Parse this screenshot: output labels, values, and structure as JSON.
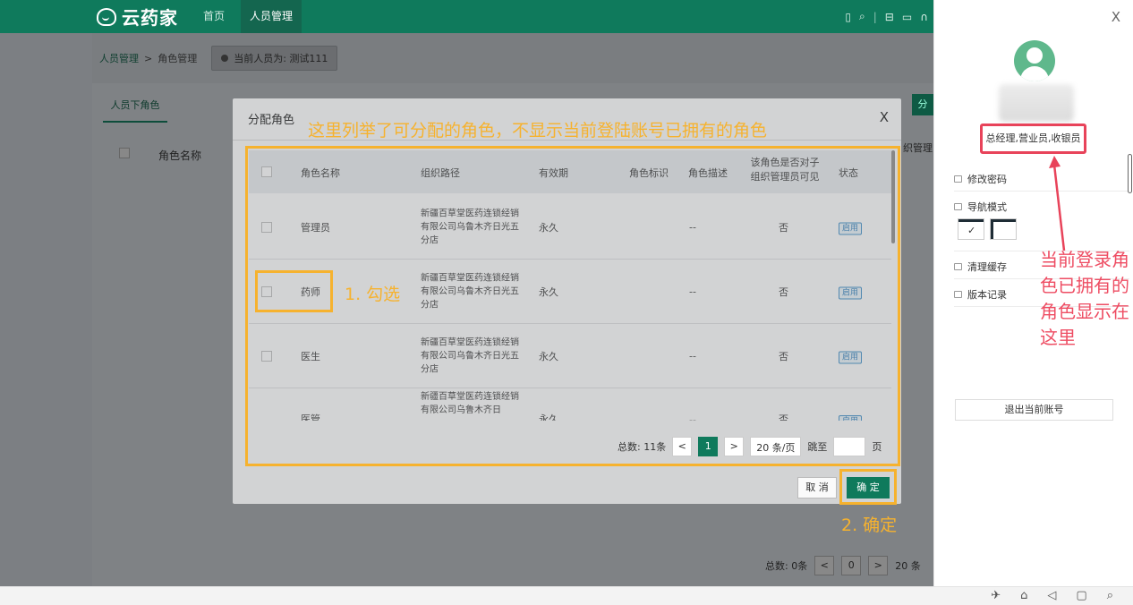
{
  "topbar": {
    "brand": "云药家",
    "nav": [
      "首页",
      "人员管理"
    ],
    "icons": [
      "book-icon",
      "search-icon",
      "lock-icon",
      "save-icon",
      "headset-icon"
    ]
  },
  "breadcrumb": {
    "parent": "人员管理",
    "separator": ">",
    "current": "角色管理",
    "current_user_label": "当前人员为: 测试111"
  },
  "background_page": {
    "tab": "人员下角色",
    "column": "角色名称",
    "right_button": "分",
    "right_text": "织管理",
    "pagination": {
      "total": "总数: 0条",
      "page": "0",
      "per_page": "20 条"
    }
  },
  "modal": {
    "title": "分配角色",
    "close": "X",
    "columns": [
      "角色名称",
      "组织路径",
      "有效期",
      "角色标识",
      "角色描述",
      "该角色是否对子组织管理员可见",
      "状态"
    ],
    "rows": [
      {
        "name": "管理员",
        "org": "新疆百草堂医药连锁经销有限公司乌鲁木齐日光五分店",
        "valid": "永久",
        "desc": "--",
        "visible": "否",
        "status": "启用"
      },
      {
        "name": "药师",
        "org": "新疆百草堂医药连锁经销有限公司乌鲁木齐日光五分店",
        "valid": "永久",
        "desc": "--",
        "visible": "否",
        "status": "启用"
      },
      {
        "name": "医生",
        "org": "新疆百草堂医药连锁经销有限公司乌鲁木齐日光五分店",
        "valid": "永久",
        "desc": "--",
        "visible": "否",
        "status": "启用"
      },
      {
        "name": "医管",
        "org": "新疆百草堂医药连锁经销有限公司乌鲁木齐日",
        "valid": "永久",
        "desc": "--",
        "visible": "否",
        "status": "启用"
      }
    ],
    "pagination": {
      "total": "总数: 11条",
      "prev": "<",
      "page": "1",
      "next": ">",
      "per_page": "20 条/页",
      "jump": "跳至",
      "page_unit": "页"
    },
    "cancel": "取 消",
    "confirm": "确 定"
  },
  "annotations": {
    "top_note": "这里列举了可分配的角色，不显示当前登陆账号已拥有的角色",
    "step1": "1. 勾选",
    "step2": "2. 确定",
    "drawer_note": "当前登录角色已拥有的角色显示在这里",
    "colors": {
      "orange": "#f6b22e",
      "red": "#e8435a"
    }
  },
  "drawer": {
    "close": "X",
    "roles": "总经理,营业员,收银员",
    "menu": [
      "修改密码",
      "导航模式",
      "清理缓存",
      "版本记录"
    ],
    "nav_mode_selected": "✓",
    "logout": "退出当前账号"
  },
  "colors": {
    "brand": "#0f7a5c",
    "accent_dark": "#14664f"
  }
}
